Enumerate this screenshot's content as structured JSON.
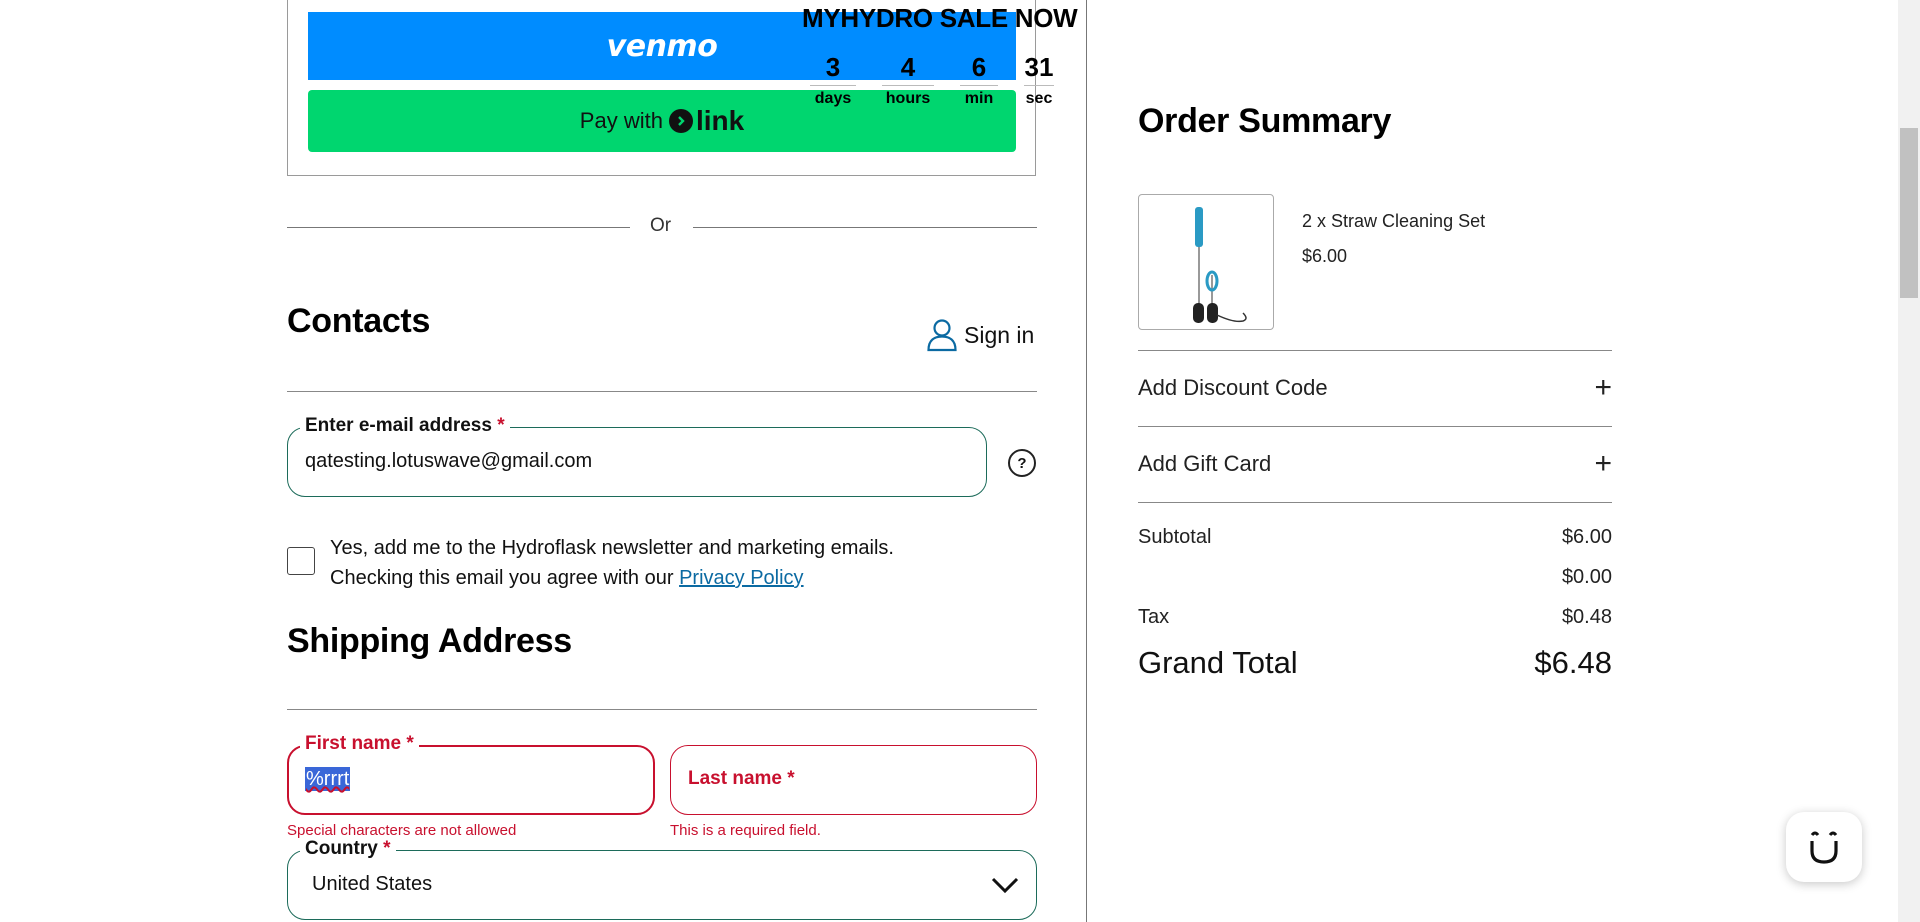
{
  "express_pay": {
    "venmo_label": "venmo",
    "link_prefix": "Pay with",
    "link_brand": "link"
  },
  "sale_banner": {
    "title": "MYHYDRO SALE NOW",
    "countdown": [
      {
        "value": "3",
        "unit": "days"
      },
      {
        "value": "4",
        "unit": "hours"
      },
      {
        "value": "6",
        "unit": "min"
      },
      {
        "value": "31",
        "unit": "sec"
      }
    ]
  },
  "divider_text": "Or",
  "contacts": {
    "title": "Contacts",
    "sign_in": "Sign in",
    "email_label": "Enter e-mail address",
    "email_value": "qatesting.lotuswave@gmail.com",
    "newsletter_line1": "Yes, add me to the Hydroflask newsletter and marketing emails.",
    "newsletter_line2_prefix": "Checking this email you agree with our",
    "privacy_link": "Privacy Policy"
  },
  "shipping": {
    "title": "Shipping Address",
    "first_name_label": "First name",
    "first_name_value": "%rrrt",
    "first_name_error": "Special characters are not allowed",
    "last_name_label": "Last name",
    "last_name_error": "This is a required field.",
    "country_label": "Country",
    "country_value": "United States"
  },
  "required_mark": "*",
  "order_summary": {
    "title": "Order Summary",
    "item_name": "2 x Straw Cleaning Set",
    "item_price": "$6.00",
    "discount_label": "Add Discount Code",
    "gift_label": "Add Gift Card",
    "subtotal_label": "Subtotal",
    "subtotal_value": "$6.00",
    "shipping_value": "$0.00",
    "tax_label": "Tax",
    "tax_value": "$0.48",
    "grand_total_label": "Grand Total",
    "grand_total_value": "$6.48"
  },
  "colors": {
    "venmo_blue": "#008cff",
    "link_green": "#00d66f",
    "field_border": "#1c6b5a",
    "error_red": "#c8102e",
    "link_blue": "#0b6aa2"
  }
}
